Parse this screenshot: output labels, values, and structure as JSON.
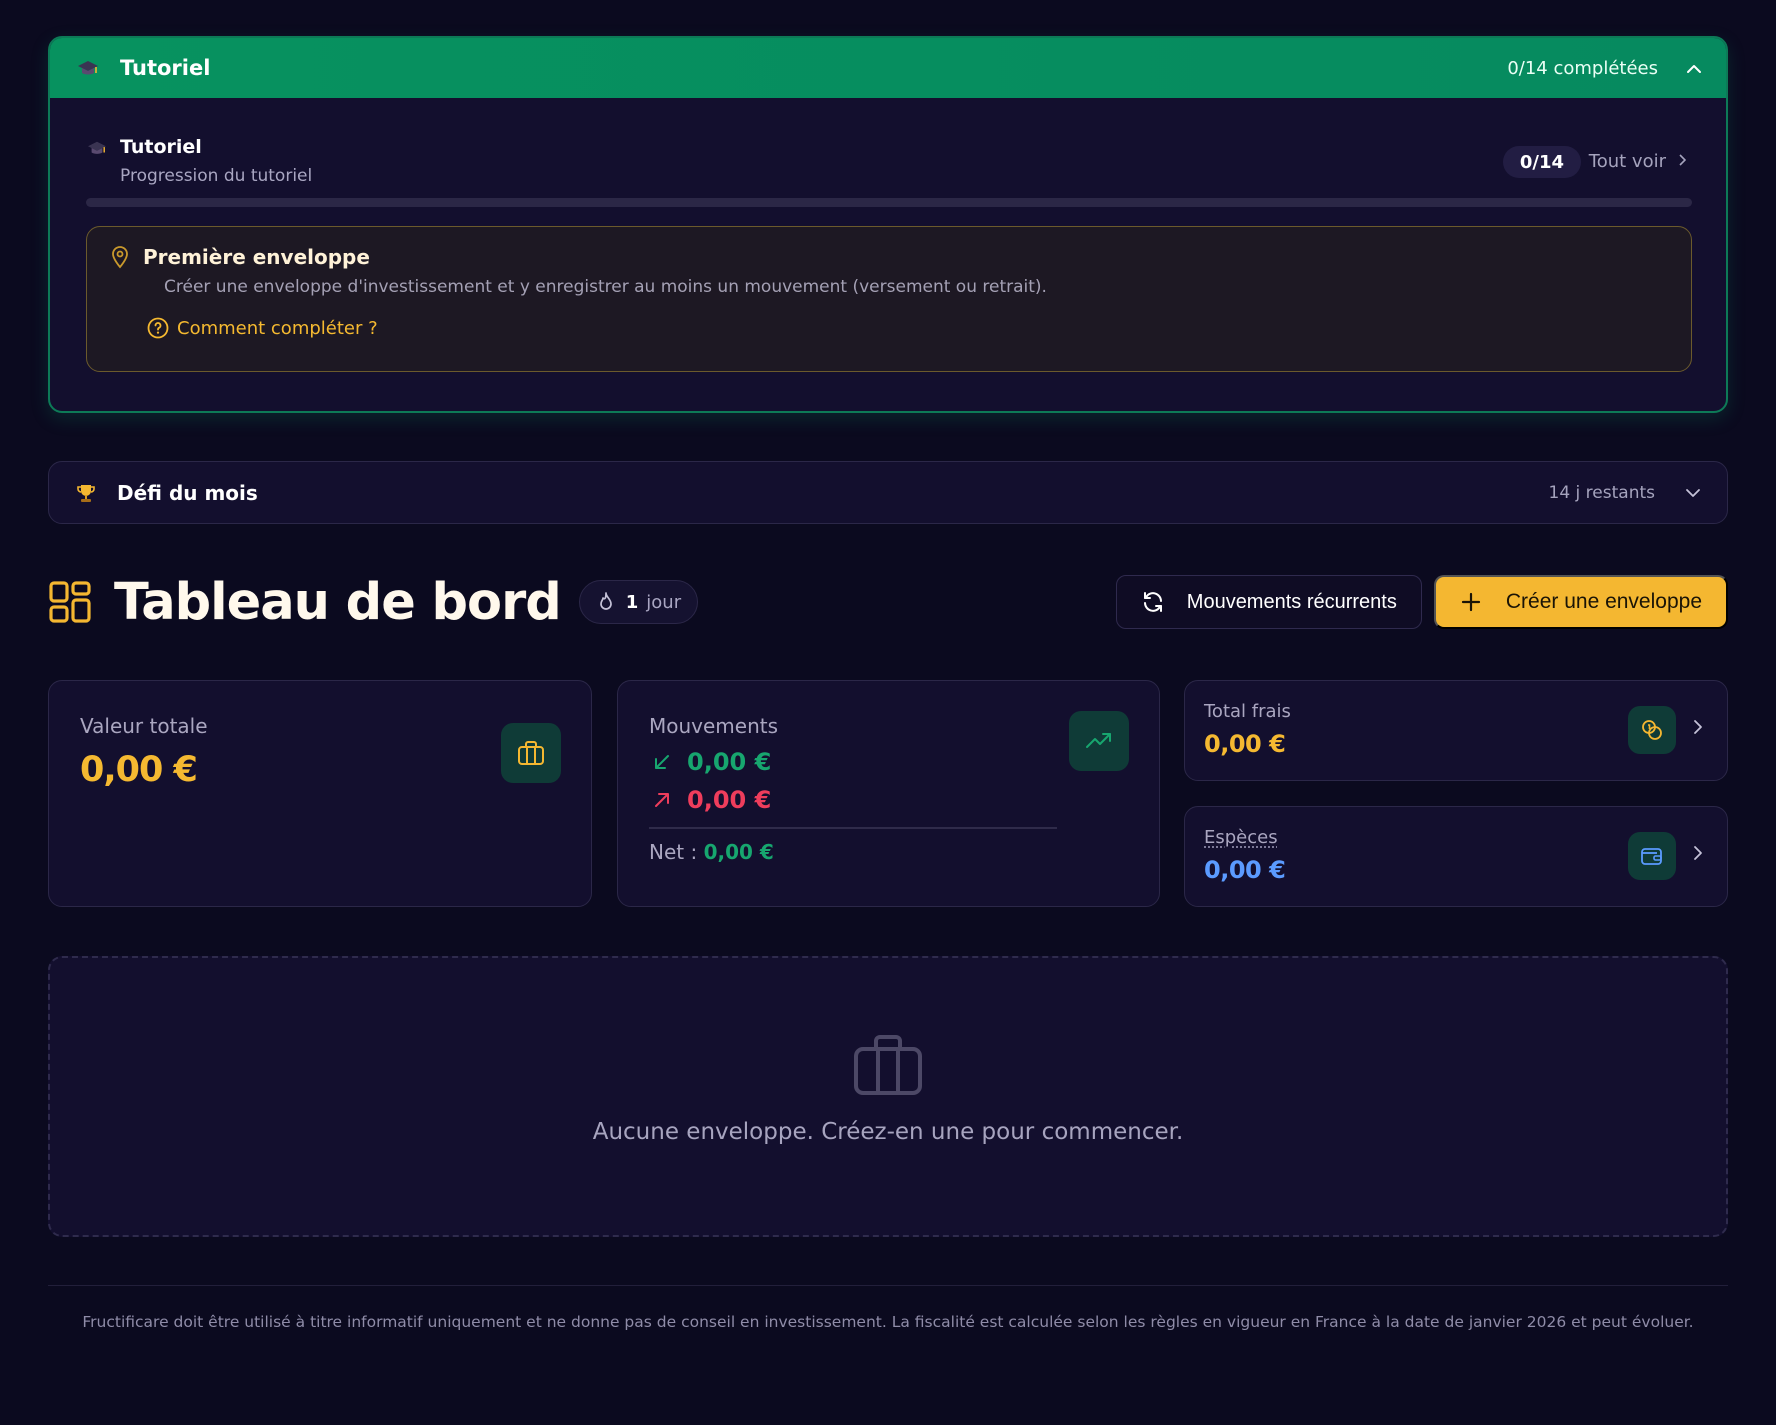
{
  "colors": {
    "background": "#0b0a1f",
    "card": "#130f2e",
    "green": "#07925f",
    "gold": "#f4b731",
    "positive": "#17a66f",
    "negative": "#ef3d5c",
    "blue": "#5b9bff"
  },
  "tutorial": {
    "header_title": "Tutoriel",
    "header_count": "0/14 complétées",
    "header_icon": "graduation-cap-icon",
    "section_title": "Tutoriel",
    "section_subtitle": "Progression du tutoriel",
    "progress_pill": "0/14",
    "see_all": "Tout voir",
    "progress_fraction": 0,
    "step": {
      "title": "Première enveloppe",
      "description": "Créer une enveloppe d'investissement et y enregistrer au moins un mouvement (versement ou retrait).",
      "help": "Comment compléter ?"
    }
  },
  "challenge": {
    "title": "Défi du mois",
    "remaining": "14 j restants",
    "icon": "trophy-icon"
  },
  "dashboard": {
    "title": "Tableau de bord",
    "streak_num": "1",
    "streak_unit": "jour",
    "recurring_button": "Mouvements récurrents",
    "create_button": "Créer une enveloppe"
  },
  "stats": {
    "total": {
      "label": "Valeur totale",
      "value": "0,00 €"
    },
    "movements": {
      "label": "Mouvements",
      "in_value": "0,00 €",
      "out_value": "0,00 €",
      "net_label": "Net :",
      "net_value": "0,00 €"
    },
    "fees": {
      "label": "Total frais",
      "value": "0,00 €"
    },
    "cash": {
      "label": "Espèces",
      "value": "0,00 €"
    }
  },
  "empty_state": {
    "message": "Aucune enveloppe. Créez-en une pour commencer."
  },
  "footer": {
    "text": "Fructificare doit être utilisé à titre informatif uniquement et ne donne pas de conseil en investissement. La fiscalité est calculée selon les règles en vigueur en France à la date de janvier 2026 et peut évoluer."
  }
}
